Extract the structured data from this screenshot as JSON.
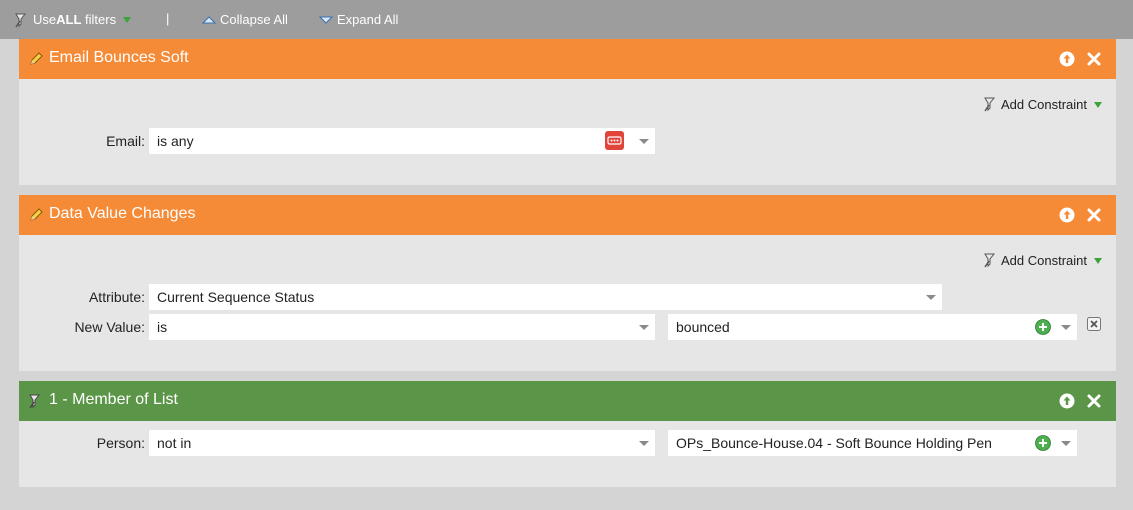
{
  "toolbar": {
    "use_prefix": "Use ",
    "use_bold": "ALL",
    "use_suffix": " filters",
    "separator": "|",
    "collapse_label": "Collapse All",
    "expand_label": "Expand All"
  },
  "panels": [
    {
      "title": "Email Bounces Soft",
      "header_color": "#f68b37",
      "add_constraint": "Add Constraint",
      "rows": [
        {
          "label": "Email:",
          "value": "is any"
        }
      ]
    },
    {
      "title": "Data Value Changes",
      "header_color": "#f68b37",
      "add_constraint": "Add Constraint",
      "rows": [
        {
          "label": "Attribute:",
          "value": "Current Sequence Status"
        },
        {
          "label": "New Value:",
          "operator": "is",
          "value": "bounced"
        }
      ]
    },
    {
      "title": "1 - Member of List",
      "header_color": "#5b9548",
      "rows": [
        {
          "label": "Person:",
          "operator": "not in",
          "value": "OPs_Bounce-House.04 - Soft Bounce Holding Pen"
        }
      ]
    }
  ],
  "colors": {
    "toolbar": "#9d9d9d",
    "orange_header": "#f68b37",
    "green_header": "#5b9548",
    "panel_body": "#e6e6e6",
    "red_badge": "#e0443a",
    "green_add": "#4caf50"
  }
}
